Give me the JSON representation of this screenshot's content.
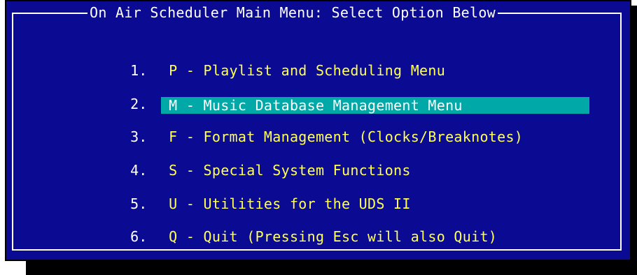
{
  "window": {
    "title": "On Air Scheduler Main Menu: Select Option Below"
  },
  "menu": {
    "items": [
      {
        "number": "1.",
        "label": "P - Playlist and Scheduling Menu",
        "selected": false
      },
      {
        "number": "2.",
        "label": "M - Music Database Management Menu",
        "selected": true
      },
      {
        "number": "3.",
        "label": "F - Format Management (Clocks/Breaknotes)",
        "selected": false
      },
      {
        "number": "4.",
        "label": "S - Special System Functions",
        "selected": false
      },
      {
        "number": "5.",
        "label": "U - Utilities for the UDS II",
        "selected": false
      },
      {
        "number": "6.",
        "label": "Q - Quit (Pressing Esc will also Quit)",
        "selected": false
      }
    ]
  },
  "colors": {
    "background": "#0a0a93",
    "menu_text": "#ffff55",
    "highlight": "#00a8a8",
    "frame": "#ffffff"
  }
}
